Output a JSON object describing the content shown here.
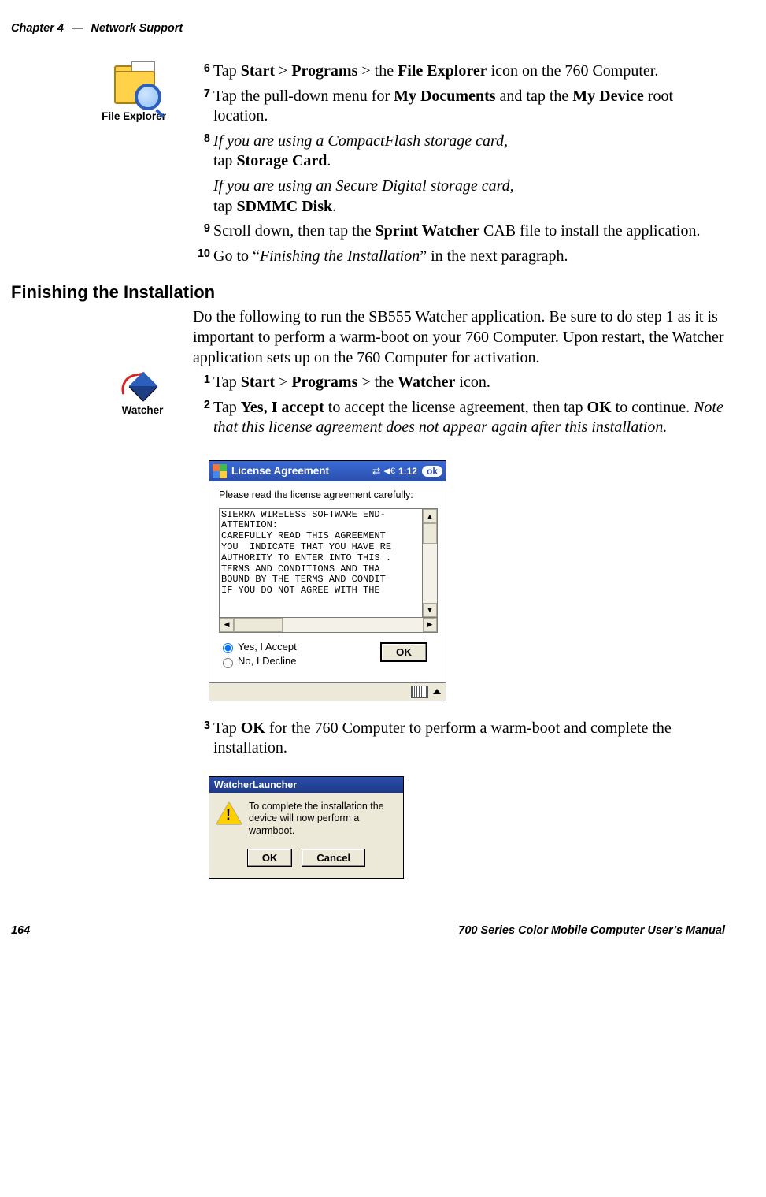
{
  "running_head": {
    "chapter": "Chapter 4",
    "dash": "—",
    "title": "Network Support"
  },
  "icons": {
    "file_explorer_label": "File Explorer",
    "watcher_label": "Watcher"
  },
  "stepsA": {
    "s6": {
      "n": "6",
      "t1": "Tap ",
      "b1": "Start",
      "t2": " > ",
      "b2": "Programs",
      "t3": " > the ",
      "b3": "File Explorer",
      "t4": " icon on the 760 Computer."
    },
    "s7": {
      "n": "7",
      "t1": "Tap the pull-down menu for ",
      "b1": "My Documents",
      "t2": " and tap the ",
      "b2": "My Device",
      "t3": " root location."
    },
    "s8": {
      "n": "8",
      "i1": "If you are using a CompactFlash storage card",
      "c": ",",
      "t1": "tap ",
      "b1": "Storage Card",
      "p": ".",
      "i2": "If you are using an Secure Digital storage card,",
      "t2": "tap ",
      "b2": "SDMMC Disk",
      "p2": "."
    },
    "s9": {
      "n": "9",
      "t1": "Scroll down, then tap the ",
      "b1": "Sprint Watcher",
      "t2": " CAB file to install the application."
    },
    "s10": {
      "n": "10",
      "t1": "Go to “",
      "i1": "Finishing the Installation",
      "t2": "” in the next paragraph."
    }
  },
  "section_heading": "Finishing the Installation",
  "intro": "Do the following to run the SB555 Watcher application. Be sure to do step 1 as it is important to perform a warm-boot on your 760 Computer. Upon restart, the Watcher application sets up on the 760 Computer for activation.",
  "stepsB": {
    "s1": {
      "n": "1",
      "t1": "Tap ",
      "b1": "Start",
      "t2": " > ",
      "b2": "Programs",
      "t3": " > the ",
      "b3": "Watcher",
      "t4": " icon."
    },
    "s2": {
      "n": "2",
      "t1": "Tap ",
      "b1": "Yes, I accept",
      "t2": " to accept the license agreement, then tap ",
      "b2": "OK",
      "t3": " to continue. ",
      "i1": "Note that this license agreement does not appear again after this installation."
    }
  },
  "screenshot1": {
    "title": "License Agreement",
    "time": "1:12",
    "ok_badge": "ok",
    "prompt": "Please read the license agreement carefully:",
    "body": "SIERRA WIRELESS SOFTWARE END-\nATTENTION:\nCAREFULLY READ THIS AGREEMENT\nYOU  INDICATE THAT YOU HAVE RE\nAUTHORITY TO ENTER INTO THIS .\nTERMS AND CONDITIONS AND THA\nBOUND BY THE TERMS AND CONDIT\nIF YOU DO NOT AGREE WITH THE ",
    "accept": "Yes, I Accept",
    "decline": "No, I Decline",
    "ok_btn": "OK"
  },
  "step3": {
    "n": "3",
    "t1": "Tap ",
    "b1": "OK",
    "t2": " for the 760 Computer to perform a warm-boot and complete the installation."
  },
  "screenshot2": {
    "title": "WatcherLauncher",
    "msg": "To complete the installation the device will now perform a warmboot.",
    "ok": "OK",
    "cancel": "Cancel"
  },
  "footer": {
    "page": "164",
    "manual": "700 Series Color Mobile Computer User’s Manual"
  },
  "chart_data": null
}
